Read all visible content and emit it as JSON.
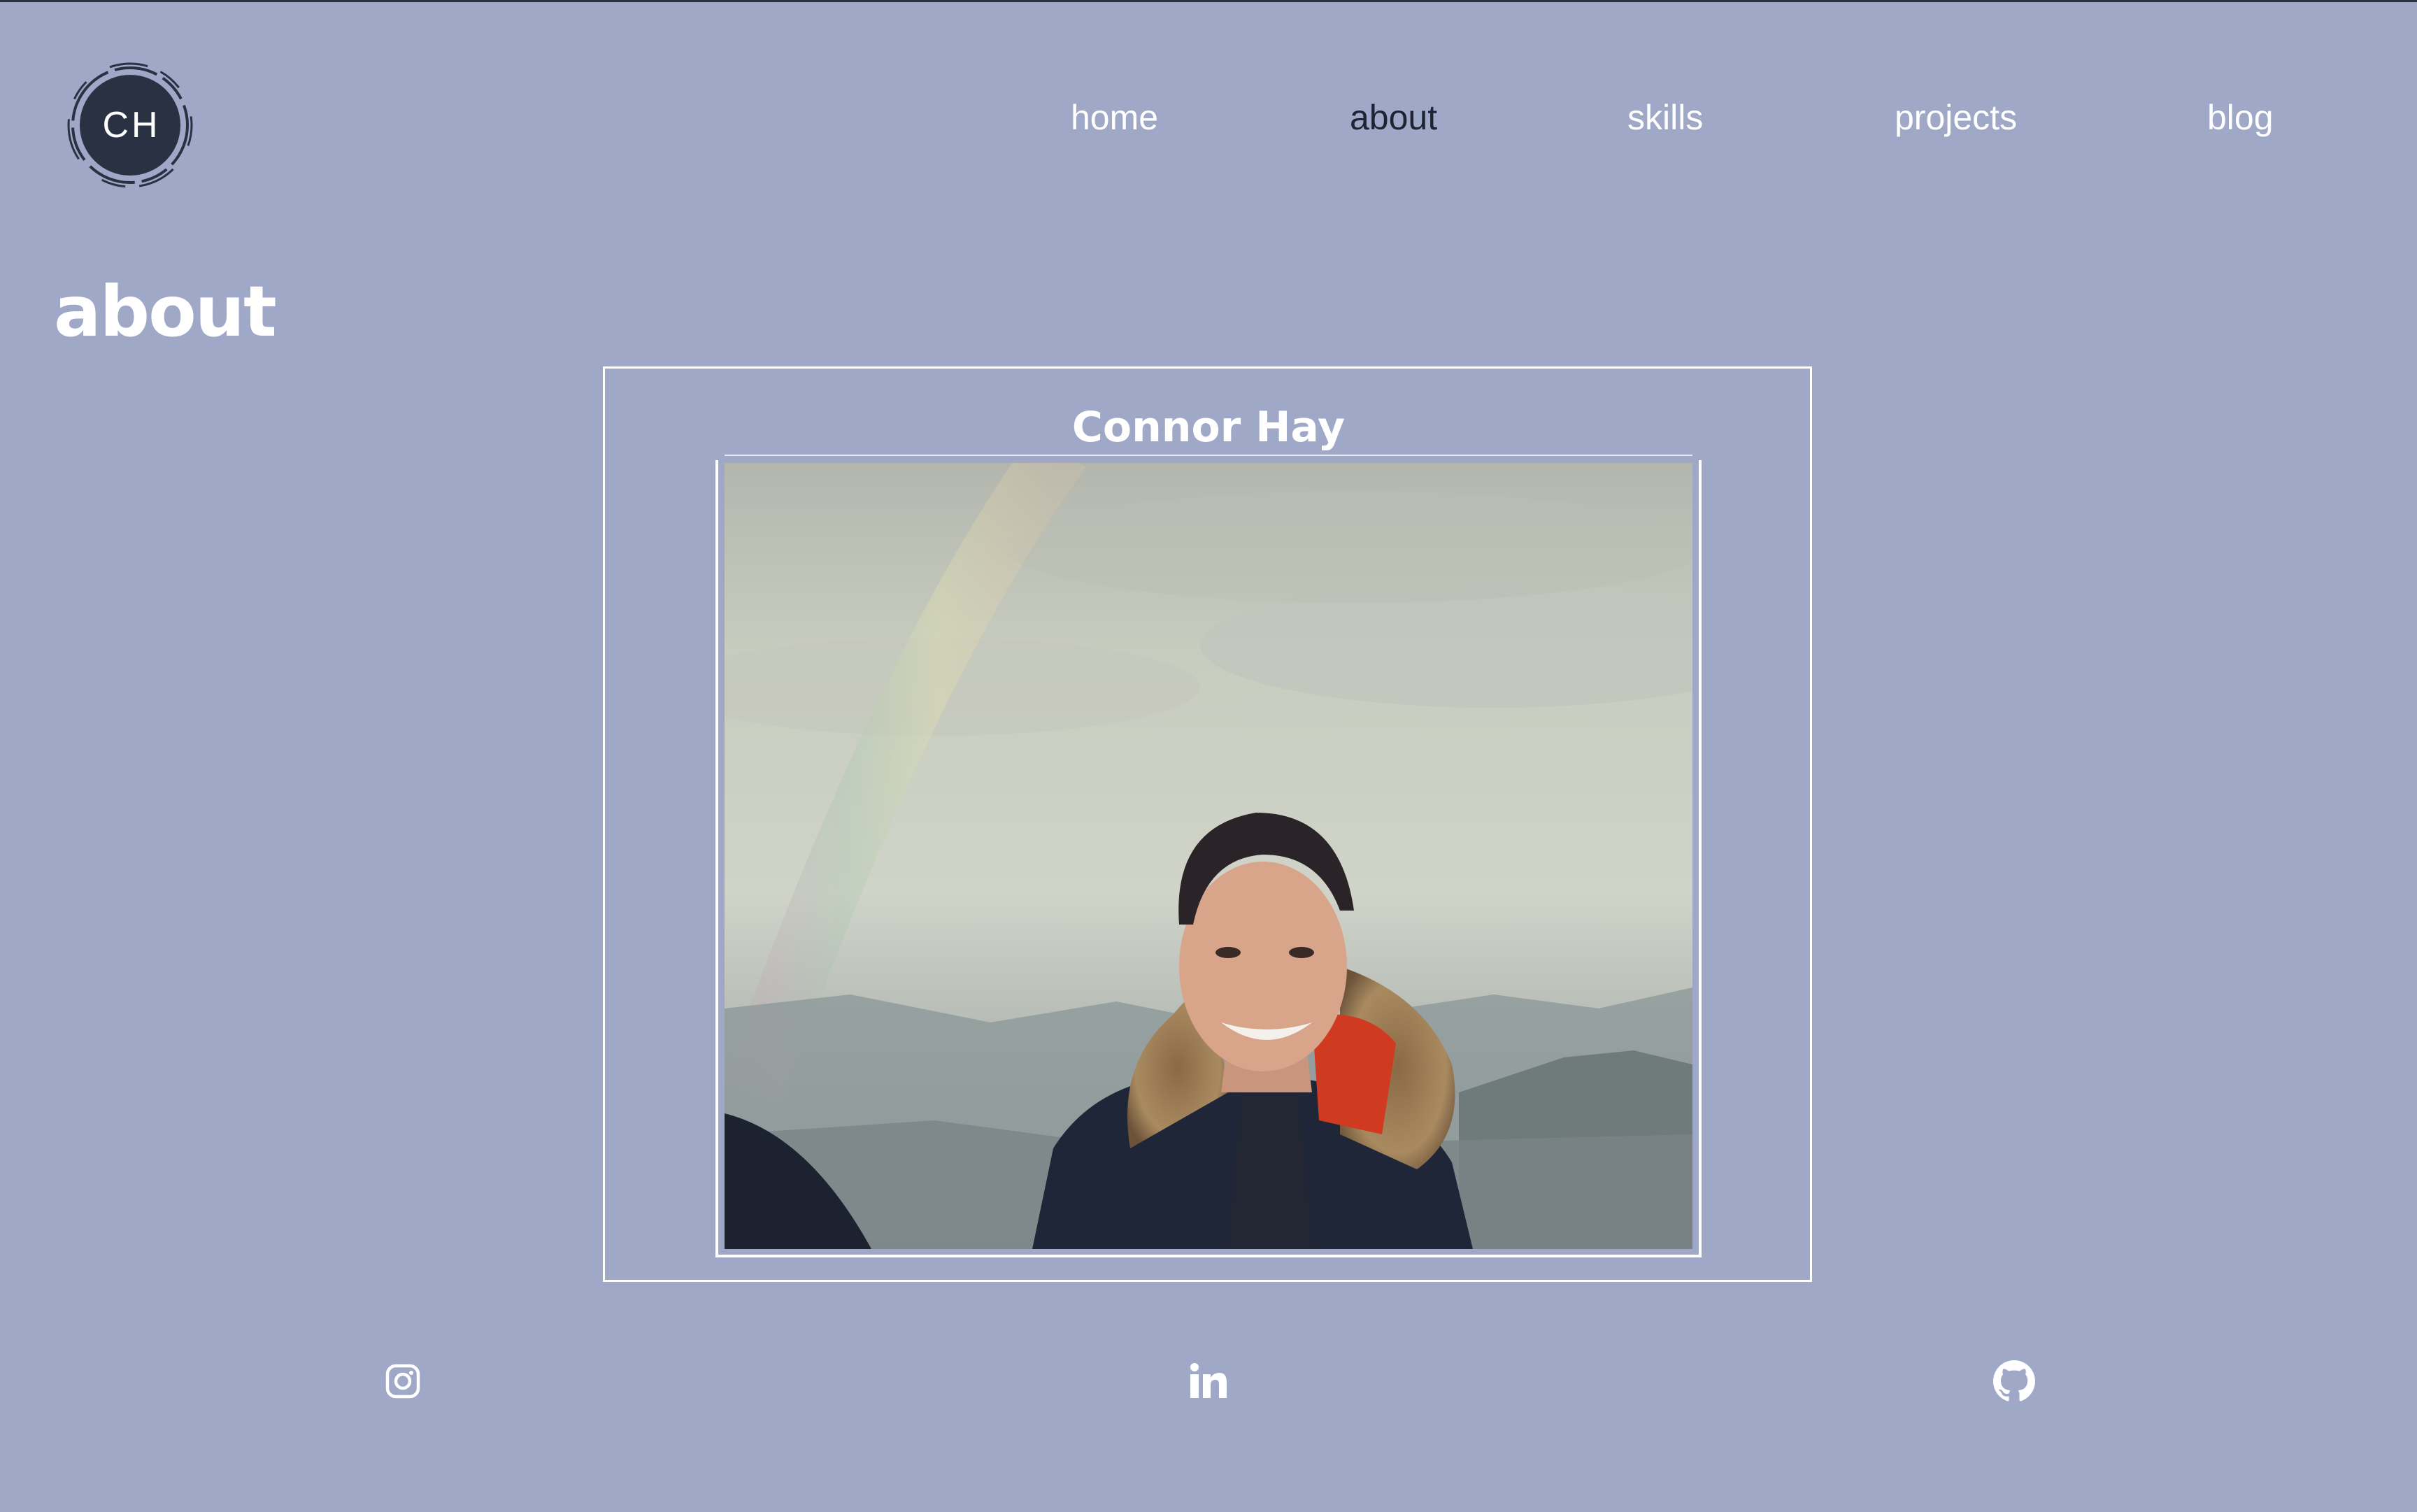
{
  "logo": {
    "initials": "CH"
  },
  "nav": {
    "items": [
      {
        "label": "home",
        "active": false
      },
      {
        "label": "about",
        "active": true
      },
      {
        "label": "skills",
        "active": false
      },
      {
        "label": "projects",
        "active": false
      },
      {
        "label": "blog",
        "active": false
      }
    ]
  },
  "page": {
    "title": "about"
  },
  "profile": {
    "name": "Connor Hay"
  },
  "social": [
    {
      "icon": "instagram-icon"
    },
    {
      "icon": "linkedin-icon"
    },
    {
      "icon": "github-icon"
    }
  ],
  "colors": {
    "background": "#9fa9c7",
    "text": "#ffffff",
    "active_nav": "#1e2433",
    "logo_fill": "#2a3142"
  }
}
